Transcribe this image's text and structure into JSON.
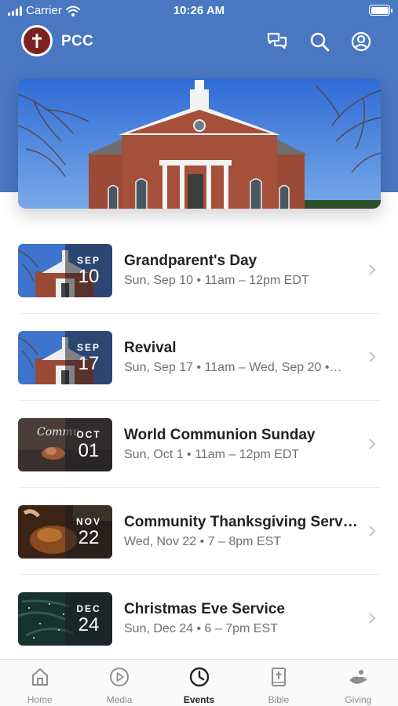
{
  "status_bar": {
    "carrier": "Carrier",
    "time": "10:26 AM"
  },
  "header": {
    "app_name": "PCC"
  },
  "events": [
    {
      "month": "SEP",
      "day": "10",
      "title": "Grandparent's Day",
      "subtitle": "Sun, Sep 10 • 11am – 12pm EDT",
      "thumb": "church"
    },
    {
      "month": "SEP",
      "day": "17",
      "title": "Revival",
      "subtitle": "Sun, Sep 17 • 11am – Wed, Sep 20 •…",
      "thumb": "church"
    },
    {
      "month": "OCT",
      "day": "01",
      "title": "World Communion Sunday",
      "subtitle": "Sun, Oct 1 • 11am – 12pm EDT",
      "thumb": "communion",
      "thumb_text": "Commu"
    },
    {
      "month": "NOV",
      "day": "22",
      "title": "Community Thanksgiving Serv…",
      "subtitle": "Wed, Nov 22 • 7 – 8pm EST",
      "thumb": "turkey"
    },
    {
      "month": "DEC",
      "day": "24",
      "title": "Christmas Eve Service",
      "subtitle": "Sun, Dec 24 • 6 – 7pm EST",
      "thumb": "tree"
    }
  ],
  "tabs": [
    {
      "label": "Home",
      "icon": "home-icon"
    },
    {
      "label": "Media",
      "icon": "play-circle-icon"
    },
    {
      "label": "Events",
      "icon": "clock-icon",
      "active": true
    },
    {
      "label": "Bible",
      "icon": "bible-icon"
    },
    {
      "label": "Giving",
      "icon": "giving-hand-icon"
    }
  ],
  "colors": {
    "header_blue": "#4a77c2",
    "logo_maroon": "#7a2320",
    "text_dark": "#222222",
    "text_muted": "#707070"
  }
}
